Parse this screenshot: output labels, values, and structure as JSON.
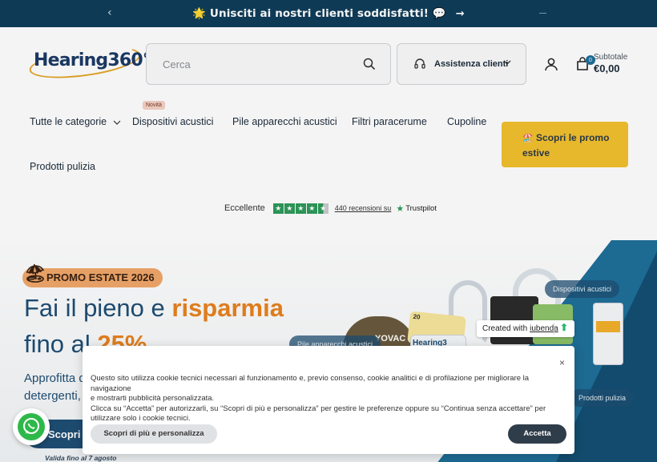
{
  "announcement": {
    "star_icon": "star-icon",
    "text": "🌟 Unisciti ai nostri clienti soddisfatti! 💬",
    "prev_symbol": "‹",
    "arrow_symbol": "→"
  },
  "header": {
    "logo_text": "Hearing360°",
    "search_placeholder": "Cerca",
    "assistance_label": "Assistenza clienti",
    "cart_count": "0",
    "subtotal_label": "Subtotale",
    "subtotal_value": "€0,00"
  },
  "nav": {
    "items": [
      {
        "label": "Tutte le categorie"
      },
      {
        "label": "Dispositivi acustici",
        "badge": "Novità"
      },
      {
        "label": "Pile apparecchi acustici"
      },
      {
        "label": "Filtri paracerume"
      },
      {
        "label": "Cupoline"
      },
      {
        "label": "Prodotti pulizia"
      }
    ],
    "promo_button": "Scopri le promo estive",
    "promo_icon": "🏖️"
  },
  "trustpilot": {
    "rating_label": "Eccellente",
    "reviews_text": "440 recensioni su",
    "brand": "Trustpilot",
    "stars": 4.5,
    "accent": "#2d9a5a"
  },
  "hero": {
    "pill": "PROMO ESTATE 2026",
    "line1_a": "Fai il pieno e ",
    "line1_b": "risparmia",
    "line2_a": "fino al ",
    "line2_b": "25%",
    "para1": "Approfitta d",
    "para2": "detergenti, ",
    "cta": "Scopri le",
    "valid": "Valida fino al 7 agosto",
    "tags": {
      "dispositivi": "Dispositivi acustici",
      "pile": "Pile apparecchi acustici",
      "pulizia": "Prodotti pulizia"
    },
    "product_texts": {
      "rayovac": "YOVAC",
      "pack": "20",
      "hearing": "Hearing3"
    }
  },
  "iubenda": {
    "prefix": "Created with",
    "link": "iubenda"
  },
  "cookie": {
    "close": "×",
    "line1": "Questo sito utilizza cookie tecnici necessari al funzionamento e, previo consenso, cookie analitici e di profilazione per migliorare la navigazione",
    "line2": "e mostrarti pubblicità personalizzata.",
    "line3": "Clicca su “Accetta” per autorizzarli, su “Scopri di più e personalizza” per gestire le preferenze oppure su “Continua senza accettare” per",
    "line4": "utilizzare solo i cookie tecnici.",
    "more_button": "Scopri di più e personalizza",
    "accept_button": "Accetta"
  },
  "colors": {
    "announcement_bg": "#0f3d5a",
    "primary": "#1f4e74",
    "promo_yellow": "#f2c12e",
    "highlight_orange": "#e8821f",
    "whatsapp_green": "#2fb84a"
  }
}
